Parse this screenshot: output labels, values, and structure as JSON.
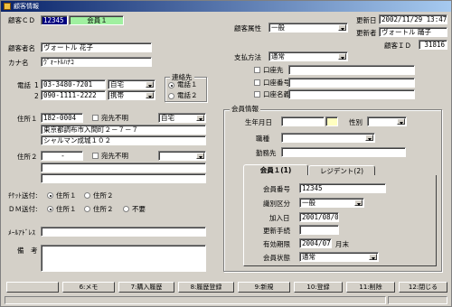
{
  "window": {
    "title": "顧客情報"
  },
  "header": {
    "customer_cd_label": "顧客ＣＤ",
    "customer_cd": "12345",
    "member_badge": "会員１",
    "attribute_label": "顧客属性",
    "attribute_value": "一般",
    "updated_date_label": "更新日",
    "updated_date": "2002/11/29 13:47",
    "updater_label": "更新者",
    "updater": "ヴォートル  踊子",
    "customer_id_label": "顧客ＩＤ",
    "customer_id": "31816"
  },
  "customer": {
    "name_label": "顧客者名",
    "name": "ヴォートル  花子",
    "kana_label": "カナ名",
    "kana": "ｳﾞｫｰﾄﾙﾊﾅｺ",
    "phone_label": "電話",
    "phone1_index": "1",
    "phone1": "03-3480-7201",
    "phone1_type": "自宅",
    "phone2_index": "2",
    "phone2": "090-1111-2222",
    "phone2_type": "携帯",
    "contact_label": "連絡先",
    "contact_phone1": "電話１",
    "contact_phone2": "電話２"
  },
  "address1": {
    "label": "住所１",
    "zip": "182-0004",
    "unknown_label": "宛先不明",
    "type": "自宅",
    "line1": "東京都調布市入間町２－７－７",
    "line2": "シャルマン成城１０２"
  },
  "address2": {
    "label": "住所２",
    "zip": "-",
    "unknown_label": "宛先不明",
    "type": "",
    "line1": "",
    "line2": ""
  },
  "delivery": {
    "ticket_label": "ﾁｹｯﾄ送付",
    "dm_label": "ＤＭ送付",
    "opt_address1": "住所１",
    "opt_address2": "住所２",
    "opt_none": "不要"
  },
  "contact": {
    "email_label": "ﾒｰﾙｱﾄﾞﾚｽ",
    "email": "",
    "remarks_label": "備　考",
    "remarks": ""
  },
  "payment": {
    "method_label": "支払方法",
    "method": "通常",
    "account_label": "口座先",
    "account_no_label": "口座番号",
    "account_name_label": "口座名義"
  },
  "member_info": {
    "group_label": "会員情報",
    "birth_label": "生年月日",
    "gender_label": "性別",
    "occupation_label": "職種",
    "workplace_label": "勤務先"
  },
  "tabs": [
    {
      "label": "会員１(1)"
    },
    {
      "label": "レジデント(2)"
    }
  ],
  "member_tab": {
    "number_label": "会員番号",
    "number": "12345",
    "category_label": "識別区分",
    "category": "一般",
    "joined_label": "加入日",
    "joined": "2001/08/01",
    "renew_label": "更新手続",
    "renew": "",
    "expiry_label": "有効期限",
    "expiry": "2004/07",
    "expiry_suffix": "月末",
    "status_label": "会員状態",
    "status": "通常"
  },
  "function_keys": [
    {
      "label": ""
    },
    {
      "label": "6:メモ"
    },
    {
      "label": "7:購入履歴"
    },
    {
      "label": "8:履歴登録"
    },
    {
      "label": "9:新規"
    },
    {
      "label": "10:登録"
    },
    {
      "label": "11:削除"
    },
    {
      "label": "12:閉じる"
    }
  ]
}
